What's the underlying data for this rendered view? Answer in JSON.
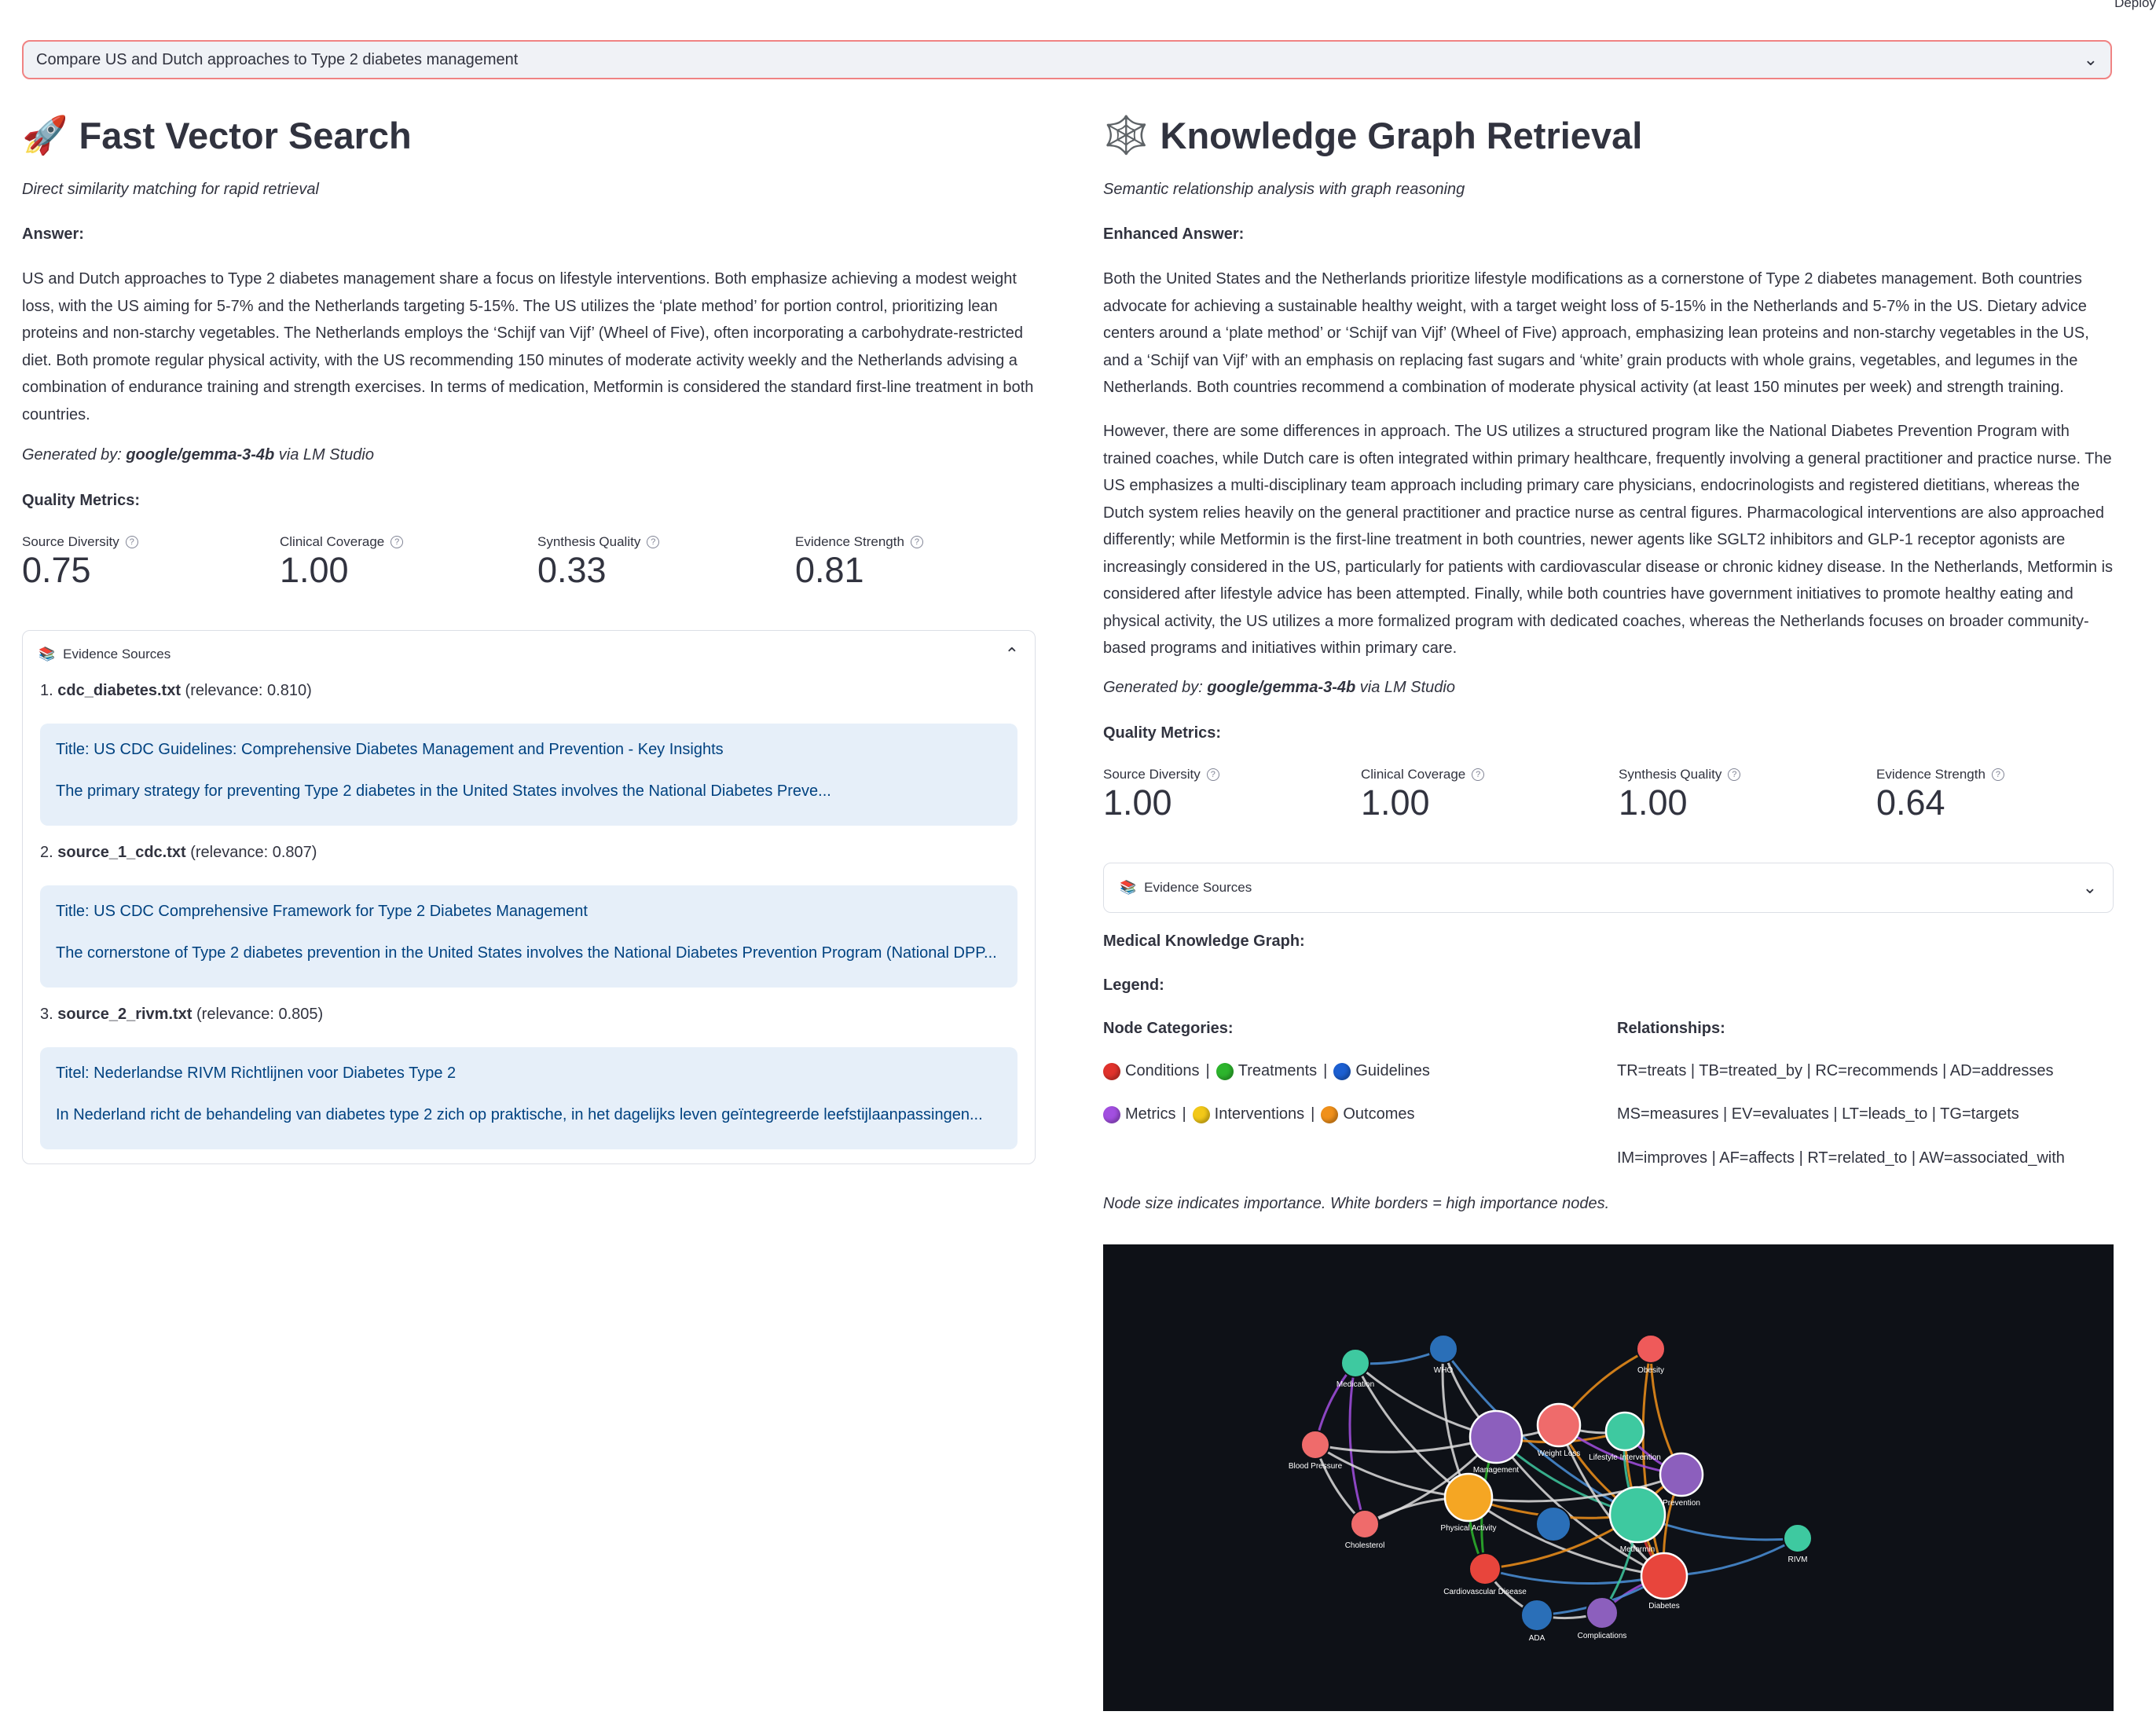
{
  "header": {
    "deploy_label": "Deploy"
  },
  "query": {
    "selected": "Compare US and Dutch approaches to Type 2 diabetes management"
  },
  "left": {
    "emoji": "🚀",
    "title": "Fast Vector Search",
    "subtitle": "Direct similarity matching for rapid retrieval",
    "answer_label": "Answer:",
    "answer": "US and Dutch approaches to Type 2 diabetes management share a focus on lifestyle interventions. Both emphasize achieving a modest weight loss, with the US aiming for 5-7% and the Netherlands targeting 5-15%. The US utilizes the ‘plate method’ for portion control, prioritizing lean proteins and non-starchy vegetables. The Netherlands employs the ‘Schijf van Vijf’ (Wheel of Five), often incorporating a carbohydrate-restricted diet. Both promote regular physical activity, with the US recommending 150 minutes of moderate activity weekly and the Netherlands advising a combination of endurance training and strength exercises. In terms of medication, Metformin is considered the standard first-line treatment in both countries.",
    "generated_prefix": "Generated by: ",
    "generated_model": "google/gemma-3-4b",
    "generated_suffix": " via LM Studio",
    "metrics_label": "Quality Metrics:",
    "metrics": [
      {
        "label": "Source Diversity",
        "value": "0.75"
      },
      {
        "label": "Clinical Coverage",
        "value": "1.00"
      },
      {
        "label": "Synthesis Quality",
        "value": "0.33"
      },
      {
        "label": "Evidence Strength",
        "value": "0.81"
      }
    ],
    "evidence": {
      "icon": "📚",
      "label": "Evidence Sources",
      "sources": [
        {
          "num": "1. ",
          "file": "cdc_diabetes.txt",
          "relevance": " (relevance: 0.810)",
          "title": "Title: US CDC Guidelines: Comprehensive Diabetes Management and Prevention - Key Insights",
          "snippet": "The primary strategy for preventing Type 2 diabetes in the United States involves the National Diabetes Preve..."
        },
        {
          "num": "2. ",
          "file": "source_1_cdc.txt",
          "relevance": " (relevance: 0.807)",
          "title": "Title: US CDC Comprehensive Framework for Type 2 Diabetes Management",
          "snippet": "The cornerstone of Type 2 diabetes prevention in the United States involves the National Diabetes Prevention Program (National DPP..."
        },
        {
          "num": "3. ",
          "file": "source_2_rivm.txt",
          "relevance": " (relevance: 0.805)",
          "title": "Titel: Nederlandse RIVM Richtlijnen voor Diabetes Type 2",
          "snippet": "In Nederland richt de behandeling van diabetes type 2 zich op praktische, in het dagelijks leven geïntegreerde leefstijlaanpassingen..."
        }
      ]
    }
  },
  "right": {
    "emoji": "🕸️",
    "title": "Knowledge Graph Retrieval",
    "subtitle": "Semantic relationship analysis with graph reasoning",
    "answer_label": "Enhanced Answer:",
    "answer_p1": "Both the United States and the Netherlands prioritize lifestyle modifications as a cornerstone of Type 2 diabetes management. Both countries advocate for achieving a sustainable healthy weight, with a target weight loss of 5-15% in the Netherlands and 5-7% in the US. Dietary advice centers around a ‘plate method’ or ‘Schijf van Vijf’ (Wheel of Five) approach, emphasizing lean proteins and non-starchy vegetables in the US, and a ‘Schijf van Vijf’ with an emphasis on replacing fast sugars and ‘white’ grain products with whole grains, vegetables, and legumes in the Netherlands. Both countries recommend a combination of moderate physical activity (at least 150 minutes per week) and strength training.",
    "answer_p2": "However, there are some differences in approach. The US utilizes a structured program like the National Diabetes Prevention Program with trained coaches, while Dutch care is often integrated within primary healthcare, frequently involving a general practitioner and practice nurse. The US emphasizes a multi-disciplinary team approach including primary care physicians, endocrinologists and registered dietitians, whereas the Dutch system relies heavily on the general practitioner and practice nurse as central figures. Pharmacological interventions are also approached differently; while Metformin is the first-line treatment in both countries, newer agents like SGLT2 inhibitors and GLP-1 receptor agonists are increasingly considered in the US, particularly for patients with cardiovascular disease or chronic kidney disease. In the Netherlands, Metformin is considered after lifestyle advice has been attempted. Finally, while both countries have government initiatives to promote healthy eating and physical activity, the US utilizes a more formalized program with dedicated coaches, whereas the Netherlands focuses on broader community-based programs and initiatives within primary care.",
    "generated_prefix": "Generated by: ",
    "generated_model": "google/gemma-3-4b",
    "generated_suffix": " via LM Studio",
    "metrics_label": "Quality Metrics:",
    "metrics": [
      {
        "label": "Source Diversity",
        "value": "1.00"
      },
      {
        "label": "Clinical Coverage",
        "value": "1.00"
      },
      {
        "label": "Synthesis Quality",
        "value": "1.00"
      },
      {
        "label": "Evidence Strength",
        "value": "0.64"
      }
    ],
    "evidence": {
      "icon": "📚",
      "label": "Evidence Sources"
    },
    "graph_label": "Medical Knowledge Graph:",
    "legend_label": "Legend:",
    "node_categories_label": "Node Categories:",
    "relationships_label": "Relationships:",
    "categories_row1": [
      {
        "name": "Conditions",
        "color": "#e0322c"
      },
      {
        "name": "Treatments",
        "color": "#2db52d"
      },
      {
        "name": "Guidelines",
        "color": "#1c5fd1"
      }
    ],
    "categories_row2": [
      {
        "name": "Metrics",
        "color": "#a24fe0"
      },
      {
        "name": "Interventions",
        "color": "#f2c818"
      },
      {
        "name": "Outcomes",
        "color": "#f0901a"
      }
    ],
    "relationships": [
      "TR=treats | TB=treated_by | RC=recommends | AD=addresses",
      "MS=measures | EV=evaluates | LT=leads_to | TG=targets",
      "IM=improves | AF=affects | RT=related_to | AW=associated_with"
    ],
    "note": "Node size indicates importance. White borders = high importance nodes.",
    "graph_nodes": [
      {
        "label": "Medication",
        "color": "#3ec9a0"
      },
      {
        "label": "WHO",
        "color": "#2a6fb8"
      },
      {
        "label": "Obesity",
        "color": "#ef5a5a"
      },
      {
        "label": "Blood Pressure",
        "color": "#ef6b6b"
      },
      {
        "label": "Management",
        "color": "#8c5fbd"
      },
      {
        "label": "Weight Loss",
        "color": "#ef6b6b"
      },
      {
        "label": "Lifestyle Intervention",
        "color": "#3ec9a0"
      },
      {
        "label": "Physical Activity",
        "color": "#f5a623"
      },
      {
        "label": "Prevention",
        "color": "#8c5fbd"
      },
      {
        "label": "Cholesterol",
        "color": "#ef6b6b"
      },
      {
        "label": "Metformin",
        "color": "#3ec9a0"
      },
      {
        "label": "RIVM",
        "color": "#3ec9a0"
      },
      {
        "label": "Cardiovascular Disease",
        "color": "#e8453c"
      },
      {
        "label": "Diabetes",
        "color": "#e8453c"
      },
      {
        "label": "ADA",
        "color": "#2a6fb8"
      },
      {
        "label": "Complications",
        "color": "#8c5fbd"
      }
    ]
  }
}
